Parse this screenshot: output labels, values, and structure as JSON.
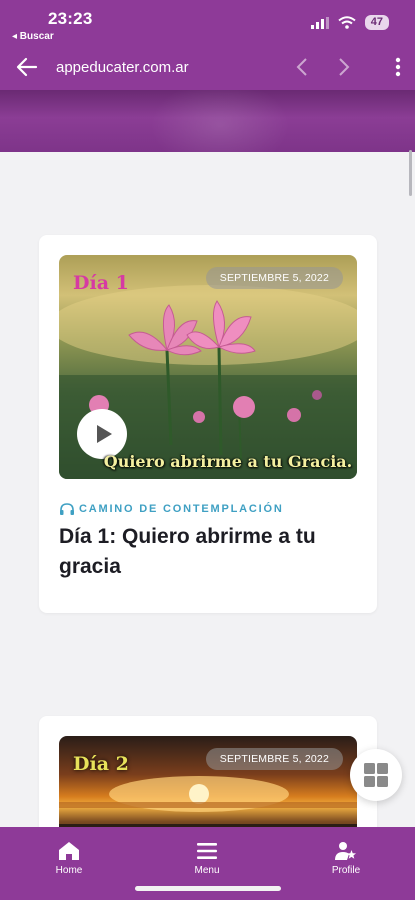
{
  "status_bar": {
    "time": "23:23",
    "back_app": "◂ Buscar",
    "battery": "47"
  },
  "browser": {
    "url": "appeducater.com.ar"
  },
  "cards": [
    {
      "day_label": "Día 1",
      "date": "SEPTIEMBRE 5, 2022",
      "image_caption": "Quiero abrirme a tu Gracia.",
      "category": "CAMINO DE CONTEMPLACIÓN",
      "title": "Día 1: Quiero abrirme a tu gracia"
    },
    {
      "day_label": "Día 2",
      "date": "SEPTIEMBRE 5, 2022"
    }
  ],
  "bottom_nav": {
    "home": "Home",
    "menu": "Menu",
    "profile": "Profile"
  },
  "colors": {
    "brand_purple": "#8e3a98",
    "category_blue": "#3fa0c3",
    "page_background": "#f2f2f4"
  },
  "icons": {
    "back": "arrow-left-icon",
    "forward": "chevron-right-icon",
    "menu": "hamburger-icon",
    "home": "home-icon",
    "profile": "user-star-icon",
    "fab": "grid-icon",
    "play": "play-icon",
    "category": "headphones-icon"
  }
}
